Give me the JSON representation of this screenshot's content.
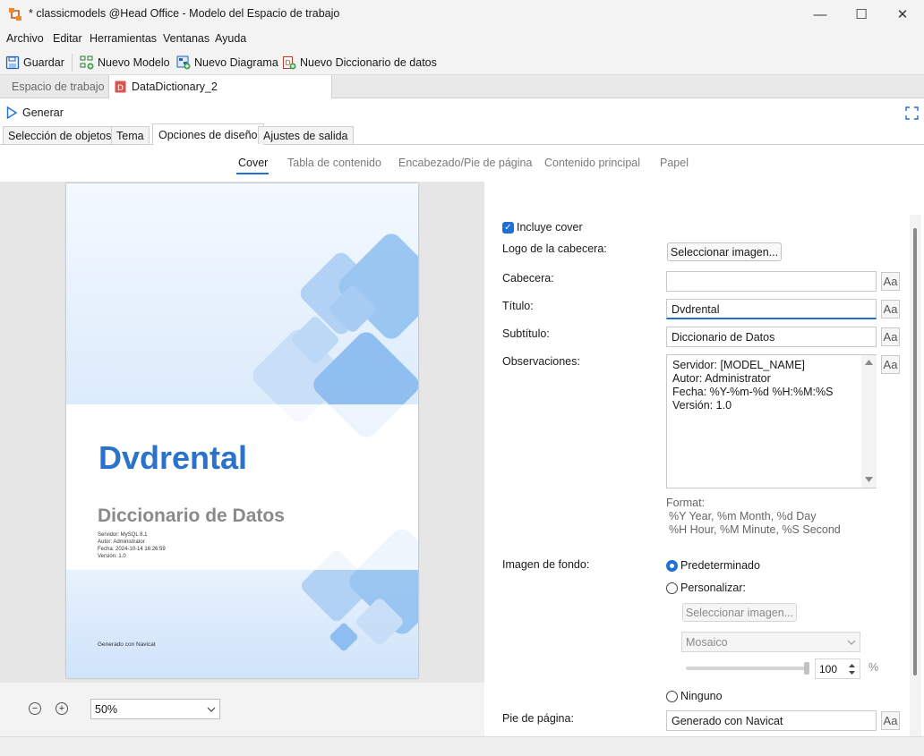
{
  "window": {
    "title": "* classicmodels @Head Office - Modelo del Espacio de trabajo",
    "minimize": "—",
    "maximize": "☐",
    "close": "✕"
  },
  "menu": [
    "Archivo",
    "Editar",
    "Herramientas",
    "Ventanas",
    "Ayuda"
  ],
  "toolbar": {
    "save": "Guardar",
    "new_model": "Nuevo Modelo",
    "new_diagram": "Nuevo Diagrama",
    "new_dictionary": "Nuevo Diccionario de datos"
  },
  "doc_tabs": [
    "Espacio de trabajo",
    "DataDictionary_2"
  ],
  "generate_label": "Generar",
  "section_tabs": [
    "Selección de objetos",
    "Tema",
    "Opciones de diseño",
    "Ajustes de salida"
  ],
  "sub_tabs": [
    "Cover",
    "Tabla de contenido",
    "Encabezado/Pie de página",
    "Contenido principal",
    "Papel"
  ],
  "preview": {
    "title": "Dvdrental",
    "subtitle": "Diccionario de Datos",
    "notes": [
      "Servidor: MySQL 8.1",
      "Autor: Administrator",
      "Fecha: 2024-10-14 16:26:59",
      "Versión: 1.0"
    ],
    "footer": "Generado con Navicat",
    "accent": "#2a72cc"
  },
  "zoom": {
    "minus": "−",
    "plus": "+",
    "value": "50%"
  },
  "settings": {
    "include_cover": "Incluye cover",
    "logo_label": "Logo de la cabecera:",
    "select_image": "Seleccionar imagen...",
    "header_label": "Cabecera:",
    "header_value": "",
    "title_label": "Título:",
    "title_value": "Dvdrental",
    "subtitle_label": "Subtítulo:",
    "subtitle_value": "Diccionario de Datos",
    "notes_label": "Observaciones:",
    "notes_value": "Servidor: [MODEL_NAME]\nAutor: Administrator\nFecha: %Y-%m-%d %H:%M:%S\nVersión: 1.0",
    "format_title": "Format:",
    "format_line1": "%Y Year, %m Month, %d Day",
    "format_line2": "%H Hour, %M Minute, %S Second",
    "bg_label": "Imagen de fondo:",
    "bg_default": "Predeterminado",
    "bg_custom": "Personalizar:",
    "bg_select_image": "Seleccionar imagen...",
    "bg_mode": "Mosaico",
    "opacity_value": "100",
    "opacity_unit": "%",
    "bg_none": "Ninguno",
    "footer_label": "Pie de página:",
    "footer_value": "Generado con Navicat",
    "font_button": "Aa"
  }
}
